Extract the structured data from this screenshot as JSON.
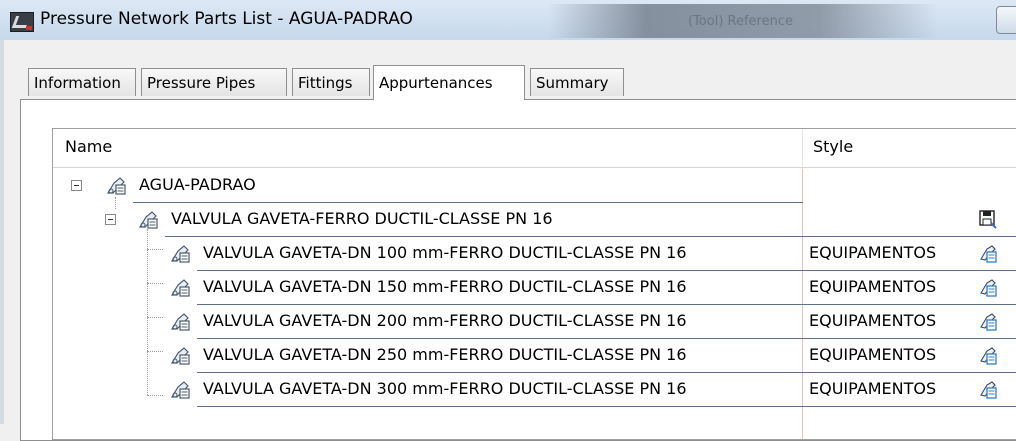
{
  "window": {
    "title": "Pressure Network Parts List - AGUA-PADRAO",
    "background_title": "(Tool) Reference"
  },
  "tabs": [
    {
      "label": "Information",
      "active": false
    },
    {
      "label": "Pressure Pipes",
      "active": false
    },
    {
      "label": "Fittings",
      "active": false
    },
    {
      "label": "Appurtenances",
      "active": true
    },
    {
      "label": "Summary",
      "active": false
    }
  ],
  "table": {
    "columns": [
      "Name",
      "Style"
    ],
    "root": {
      "name": "AGUA-PADRAO",
      "style": ""
    },
    "group": {
      "name": "VALVULA GAVETA-FERRO DUCTIL-CLASSE PN 16",
      "style": ""
    },
    "items": [
      {
        "name": "VALVULA GAVETA-DN 100 mm-FERRO DUCTIL-CLASSE PN 16",
        "style": "EQUIPAMENTOS"
      },
      {
        "name": "VALVULA GAVETA-DN 150 mm-FERRO DUCTIL-CLASSE PN 16",
        "style": "EQUIPAMENTOS"
      },
      {
        "name": "VALVULA GAVETA-DN 200 mm-FERRO DUCTIL-CLASSE PN 16",
        "style": "EQUIPAMENTOS"
      },
      {
        "name": "VALVULA GAVETA-DN 250 mm-FERRO DUCTIL-CLASSE PN 16",
        "style": "EQUIPAMENTOS"
      },
      {
        "name": "VALVULA GAVETA-DN 300 mm-FERRO DUCTIL-CLASSE PN 16",
        "style": "EQUIPAMENTOS"
      }
    ]
  },
  "icons": {
    "app": "civil3d-app-icon",
    "part": "pressure-part-icon",
    "save": "save-style-icon",
    "style": "style-picker-icon"
  },
  "colors": {
    "row_line": "#5e6f8a",
    "style_separator": "#f4b8b8"
  }
}
